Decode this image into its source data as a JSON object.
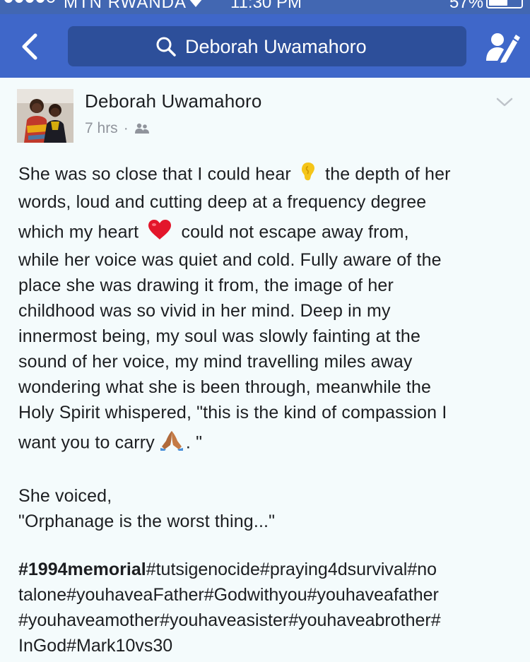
{
  "status_bar": {
    "carrier": "MTN RWANDA",
    "time": "11:30 PM",
    "battery": "57%",
    "battery_level": 0.57
  },
  "nav": {
    "search_query": "Deborah Uwamahoro",
    "back_icon": "chevron-left-icon",
    "profile_icon": "person-edit-icon",
    "search_icon": "magnifier-icon"
  },
  "post": {
    "author": "Deborah Uwamahoro",
    "time_ago": "7 hrs",
    "separator": "·",
    "audience_icon": "friends-icon",
    "options_icon": "chevron-down-icon",
    "lines": [
      "She was so close that I could hear",
      "the depth of her",
      "words, loud and cutting deep at a frequency degree",
      "which my heart",
      "could not escape away from,",
      "while her voice was quiet and cold. Fully aware of the",
      "place she was drawing it from, the image of her",
      "childhood was so vivid in her mind. Deep in my",
      "innermost being, my soul was slowly fainting at the",
      "sound of her voice, my mind travelling miles away",
      "wondering what she is been through, meanwhile the",
      "Holy Spirit whispered, \"this is the kind of compassion I",
      "want you to carry",
      ". \""
    ],
    "voiced_lines": [
      "She voiced,",
      "\"Orphanage is the worst thing...\""
    ],
    "hashtag_bold": "#1994memorial",
    "hashtag_lines": [
      "#tutsigenocide#praying4dsurvival#no",
      "talone#youhaveaFather#Godwithyou#youhaveafather",
      "#youhaveamother#youhaveasister#youhaveabrother#",
      "InGod#Mark10vs30"
    ]
  }
}
